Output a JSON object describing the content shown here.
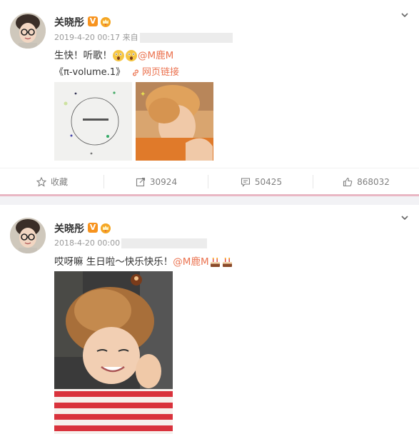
{
  "posts": [
    {
      "username": "关晓彤",
      "verified_badge": "V",
      "timestamp": "2019-4-20 00:17",
      "source_prefix": "来自",
      "text_prefix": "生快！听歌！",
      "mention": "@M鹿M",
      "album_title": "《π-volume.1》",
      "web_link_label": "网页链接",
      "actions": {
        "favorite": "收藏",
        "repost": "30924",
        "comment": "50425",
        "like": "868032"
      }
    },
    {
      "username": "关晓彤",
      "verified_badge": "V",
      "timestamp": "2018-4-20 00:00",
      "text_prefix": "哎呀嘛 生日啦～快乐快乐！",
      "mention": "@M鹿M"
    }
  ],
  "colors": {
    "mention": "#eb7350",
    "verified": "#f7931e",
    "divider_pink": "#e9b7c4",
    "muted": "#808080"
  },
  "icons": [
    "chevron-down-icon",
    "star-icon",
    "repost-icon",
    "comment-icon",
    "thumbs-up-icon",
    "link-icon",
    "crown-icon",
    "emoji-surprised-icon",
    "cake-icon"
  ]
}
